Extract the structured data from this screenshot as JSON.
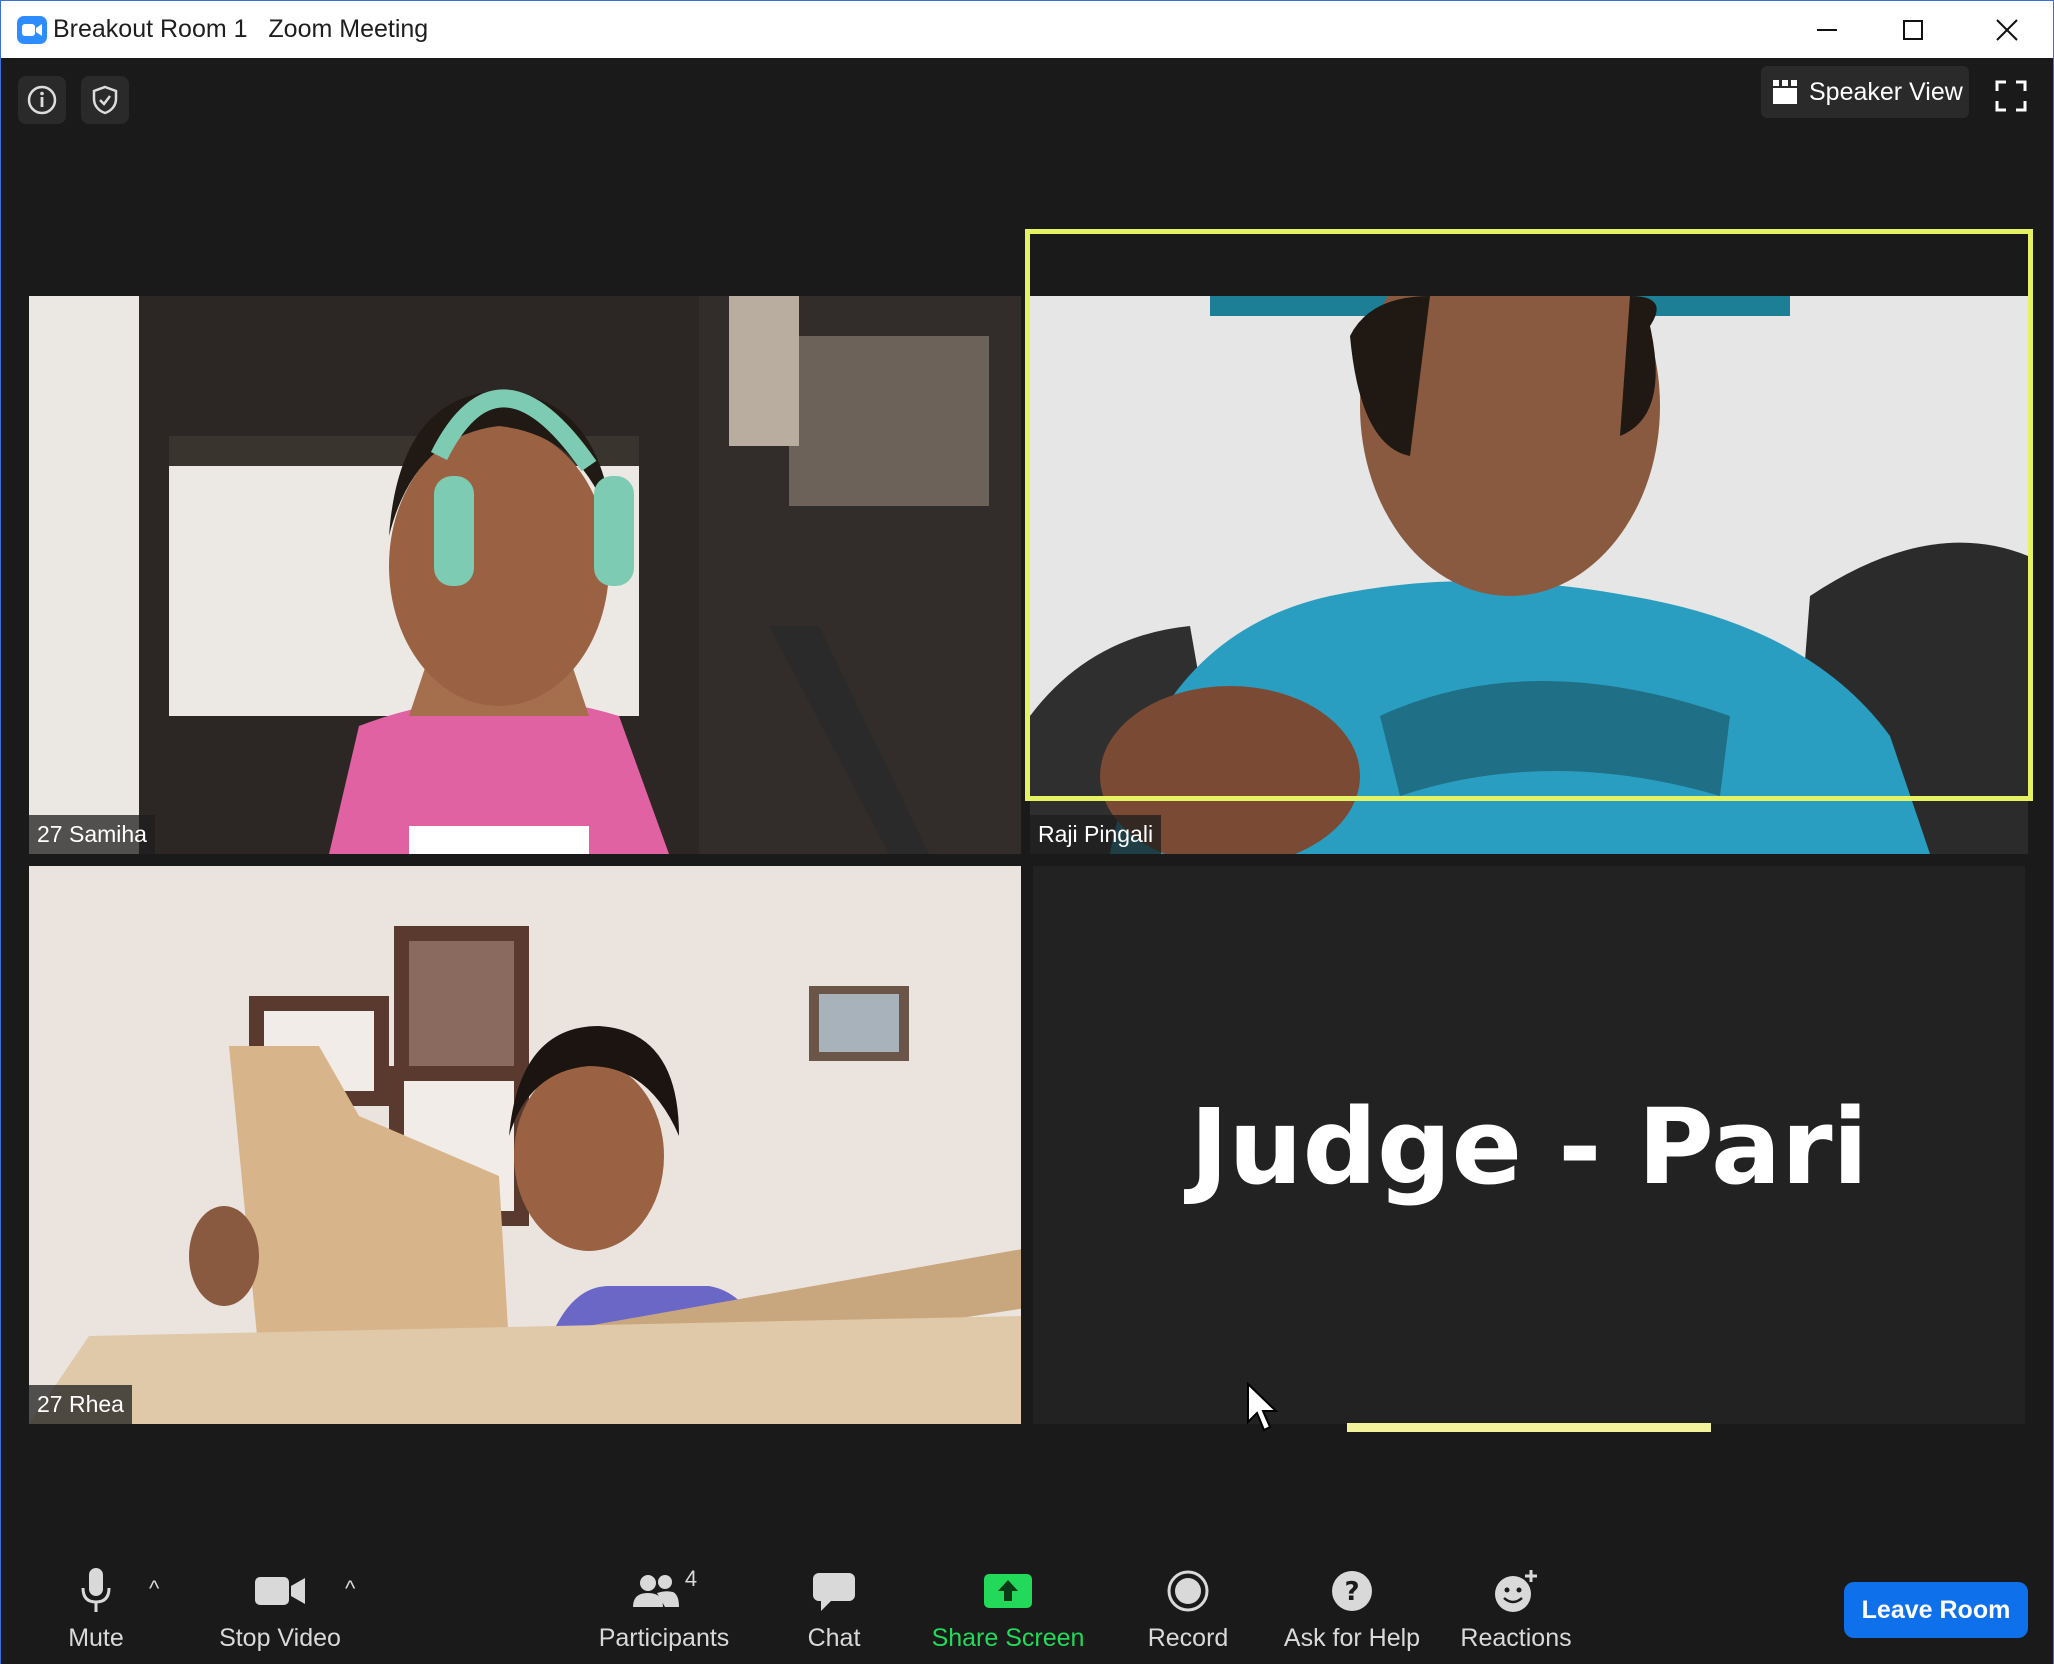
{
  "window": {
    "title_room": "Breakout Room 1",
    "title_app": "Zoom Meeting"
  },
  "top_bar": {
    "speaker_view_label": "Speaker View"
  },
  "tiles": [
    {
      "name": "27 Samiha"
    },
    {
      "name": "Raji Pingali",
      "active_speaker": true
    },
    {
      "name": "27 Rhea"
    },
    {
      "name": "Judge - Pari",
      "video_off": true
    }
  ],
  "toolbar": {
    "mute_label": "Mute",
    "stop_video_label": "Stop Video",
    "participants_label": "Participants",
    "participants_count": "4",
    "chat_label": "Chat",
    "share_screen_label": "Share Screen",
    "record_label": "Record",
    "ask_for_help_label": "Ask for Help",
    "reactions_label": "Reactions",
    "leave_label": "Leave Room",
    "caret": "^"
  },
  "colors": {
    "active_speaker_border": "#e5f261",
    "share_screen_green": "#23d959",
    "leave_button_blue": "#0e71eb",
    "background": "#1a1a1a"
  }
}
